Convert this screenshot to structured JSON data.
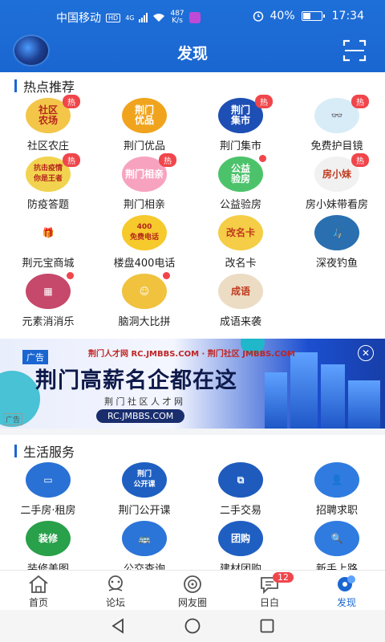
{
  "status_bar": {
    "carrier": "中国移动",
    "network_tag": "HD",
    "signal_tag": "4G",
    "speed_value": "487",
    "speed_unit": "K/s",
    "battery": "40%",
    "time": "17:34"
  },
  "header": {
    "title": "发现"
  },
  "hot": {
    "title": "热点推荐",
    "items": [
      {
        "label": "社区农庄",
        "icon_text": "社区\n农场",
        "icon_color": "#f3c64a",
        "badge": "热"
      },
      {
        "label": "荆门优品",
        "icon_text": "荆门\n优品",
        "icon_color": "#f0a41e",
        "badge": null
      },
      {
        "label": "荆门集市",
        "icon_text": "荆门\n集市",
        "icon_color": "#1d4fb5",
        "badge": "热"
      },
      {
        "label": "免费护目镜",
        "icon_text": "👓",
        "icon_color": "#d8ecf7",
        "badge": "热"
      },
      {
        "label": "防疫答题",
        "icon_text": "抗击疫情\n你是王者",
        "icon_color": "#f2d34f",
        "badge": "热"
      },
      {
        "label": "荆门相亲",
        "icon_text": "荆门相亲",
        "icon_color": "#f7a3c0",
        "badge": "热"
      },
      {
        "label": "公益验房",
        "icon_text": "公益\n验房",
        "icon_color": "#4cc36b",
        "badge": "dot"
      },
      {
        "label": "房小妹带看房",
        "icon_text": "房小妹",
        "icon_color": "#f1f1f1",
        "badge": "热"
      },
      {
        "label": "荆元宝商城",
        "icon_text": "🎁",
        "icon_color": "#ffffff",
        "badge": null
      },
      {
        "label": "楼盘400电话",
        "icon_text": "400\n免费电话",
        "icon_color": "#f6c92c",
        "badge": null
      },
      {
        "label": "改名卡",
        "icon_text": "改名卡",
        "icon_color": "#f5cd46",
        "badge": null
      },
      {
        "label": "深夜钓鱼",
        "icon_text": "🎣",
        "icon_color": "#2a6fb0",
        "badge": null
      },
      {
        "label": "元素消消乐",
        "icon_text": "▦",
        "icon_color": "#c6486b",
        "badge": "dot"
      },
      {
        "label": "脑洞大比拼",
        "icon_text": "☺",
        "icon_color": "#f0c23e",
        "badge": "dot"
      },
      {
        "label": "成语来袭",
        "icon_text": "成语",
        "icon_color": "#ecdcc4",
        "badge": null
      }
    ]
  },
  "ad": {
    "tag": "广告",
    "small_tag": "广告",
    "brand": "荆门人才网 RC.JMBBS.COM · 荆门社区 JMBBS.COM",
    "headline": "荆门高薪名企都在这",
    "subline": "荆 门 社 区 人 才 网",
    "url": "RC.JMBBS.COM",
    "close": "✕"
  },
  "services": {
    "title": "生活服务",
    "items": [
      {
        "label": "二手房·租房",
        "icon_text": "▭",
        "icon_color": "#2a71d6"
      },
      {
        "label": "荆门公开课",
        "icon_text": "荆门\n公开课",
        "icon_color": "#1f5fc2"
      },
      {
        "label": "二手交易",
        "icon_text": "⧉",
        "icon_color": "#1e5bbd"
      },
      {
        "label": "招聘求职",
        "icon_text": "👤",
        "icon_color": "#2f7be0"
      },
      {
        "label": "装修美图",
        "icon_text": "装修",
        "icon_color": "#29a04a"
      },
      {
        "label": "公交查询",
        "icon_text": "🚌",
        "icon_color": "#2b74d8"
      },
      {
        "label": "建材团购",
        "icon_text": "团购",
        "icon_color": "#1f5fc2"
      },
      {
        "label": "新手上路",
        "icon_text": "🔍",
        "icon_color": "#2f7be0"
      }
    ]
  },
  "tabbar": {
    "tabs": [
      {
        "label": "首页",
        "icon": "home-icon"
      },
      {
        "label": "论坛",
        "icon": "forum-icon"
      },
      {
        "label": "网友圈",
        "icon": "circle-icon"
      },
      {
        "label": "日白",
        "icon": "chat-icon",
        "badge": "12"
      },
      {
        "label": "发现",
        "icon": "discover-icon",
        "active": true
      }
    ]
  },
  "colors": {
    "primary": "#1a66d1",
    "badge_red": "#f0464b"
  }
}
